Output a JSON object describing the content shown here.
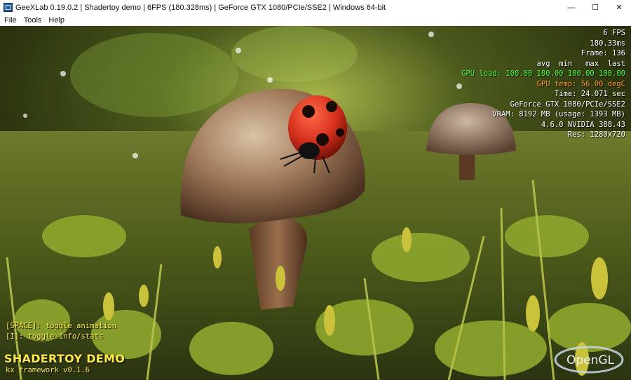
{
  "window": {
    "title": "GeeXLab 0.19.0.2 | Shadertoy demo | 6FPS (180.328ms) | GeForce GTX 1080/PCIe/SSE2 | Windows 64-bit",
    "minimize_glyph": "—",
    "maximize_glyph": "☐",
    "close_glyph": "✕"
  },
  "menu": {
    "items": [
      "File",
      "Tools",
      "Help"
    ]
  },
  "hud": {
    "fps": "6 FPS",
    "ms": "180.33ms",
    "frame": "Frame: 136",
    "header": "avg  min   max  last",
    "gpu_load": "GPU load: 100.00 100.00 100.00 100.00",
    "gpu_temp": "GPU temp: 56.00 degC",
    "time": "Time: 24.071 sec",
    "renderer": "GeForce GTX 1080/PCIe/SSE2",
    "vram": "VRAM: 8192 MB (usage: 1393 MB)",
    "gl_version": "4.6.0 NVIDIA 388.43",
    "res": "Res: 1280x720"
  },
  "overlay": {
    "key_space": "[SPACE]: toggle animation",
    "key_i": "[I]: toggle info/stats",
    "demo_title": "SHADERTOY DEMO",
    "framework": "kx framework v0.1.6",
    "logo_text": "OpenGL"
  },
  "colors": {
    "hud_text": "#ffffff",
    "gpu_load": "#4cff3a",
    "gpu_temp": "#ff9a1a",
    "overlay_yellow": "#ffe94a"
  }
}
